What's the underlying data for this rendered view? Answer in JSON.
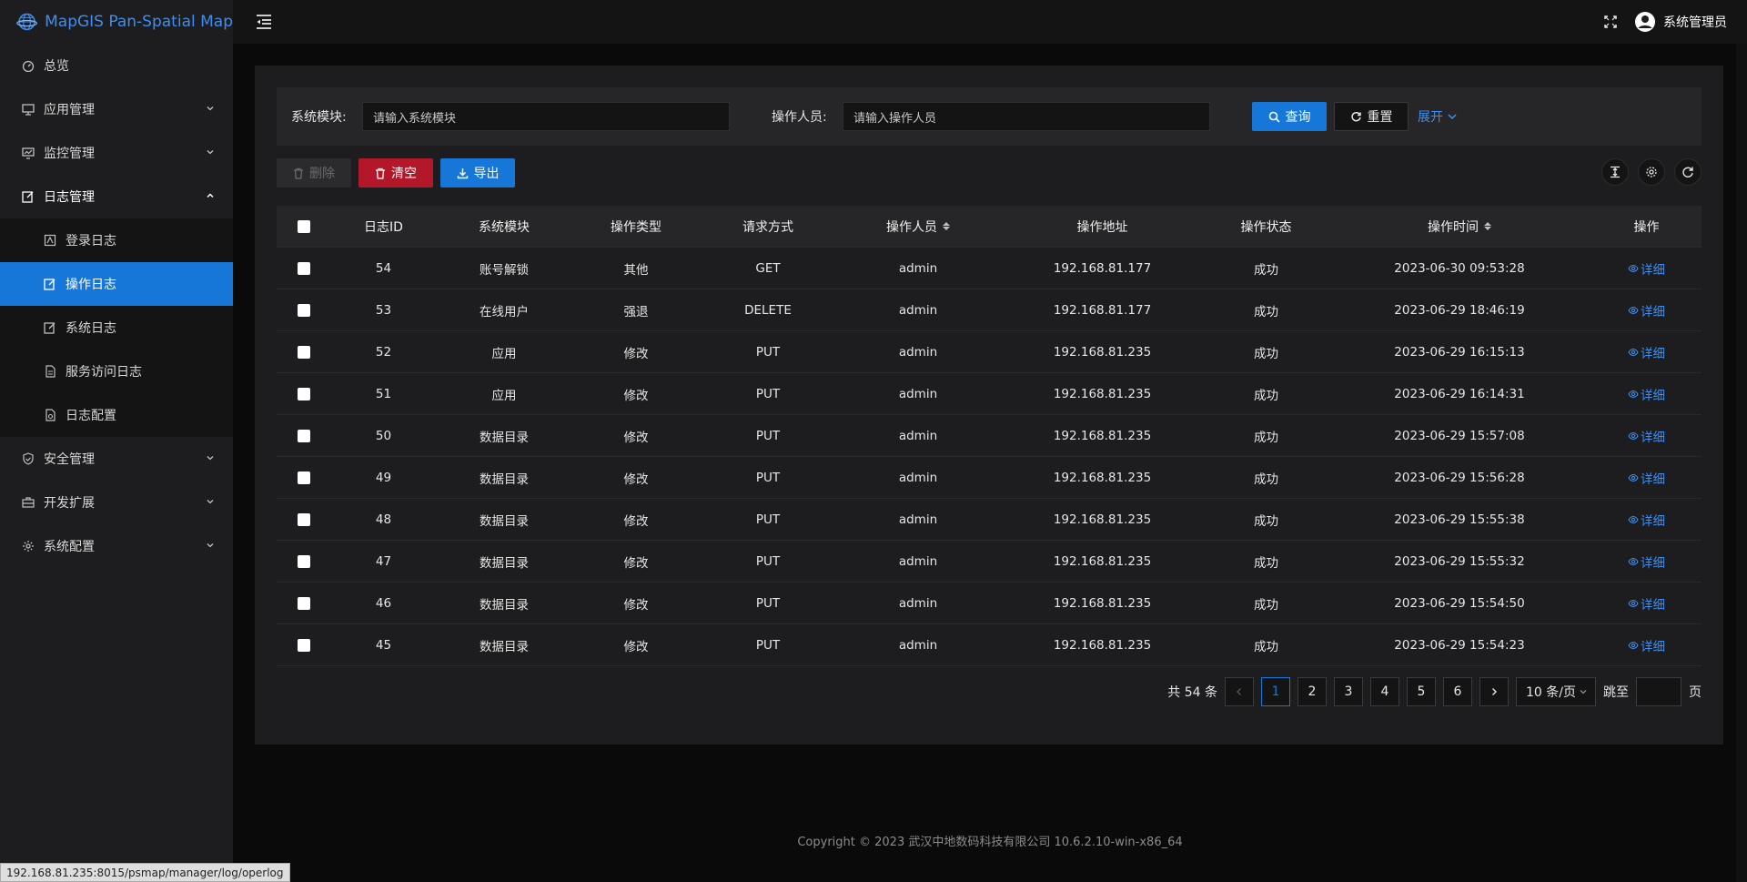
{
  "app": {
    "title": "MapGIS Pan-Spatial Map"
  },
  "colors": {
    "accent": "#1677d9",
    "danger": "#b3182a",
    "link": "#3d8ef0"
  },
  "sidebar": {
    "items": [
      {
        "label": "总览",
        "icon": "dashboard-icon"
      },
      {
        "label": "应用管理",
        "icon": "monitor-icon"
      },
      {
        "label": "监控管理",
        "icon": "chart-monitor-icon"
      },
      {
        "label": "日志管理",
        "icon": "edit-log-icon"
      },
      {
        "label": "安全管理",
        "icon": "shield-icon"
      },
      {
        "label": "开发扩展",
        "icon": "toolbox-icon"
      },
      {
        "label": "系统配置",
        "icon": "gear-icon"
      }
    ],
    "log_sub": [
      {
        "label": "登录日志",
        "icon": "login-log-icon"
      },
      {
        "label": "操作日志",
        "icon": "edit-icon"
      },
      {
        "label": "系统日志",
        "icon": "edit-icon"
      },
      {
        "label": "服务访问日志",
        "icon": "file-icon"
      },
      {
        "label": "日志配置",
        "icon": "file-config-icon"
      }
    ]
  },
  "header": {
    "user": "系统管理员"
  },
  "search": {
    "module_label": "系统模块:",
    "module_placeholder": "请输入系统模块",
    "operator_label": "操作人员:",
    "operator_placeholder": "请输入操作人员",
    "query": "查询",
    "reset": "重置",
    "expand": "展开"
  },
  "toolbar": {
    "delete": "删除",
    "clear": "清空",
    "export": "导出"
  },
  "table": {
    "columns": [
      "日志ID",
      "系统模块",
      "操作类型",
      "请求方式",
      "操作人员",
      "操作地址",
      "操作状态",
      "操作时间",
      "操作"
    ],
    "detail_label": "详细",
    "rows": [
      [
        "54",
        "账号解锁",
        "其他",
        "GET",
        "admin",
        "192.168.81.177",
        "成功",
        "2023-06-30 09:53:28"
      ],
      [
        "53",
        "在线用户",
        "强退",
        "DELETE",
        "admin",
        "192.168.81.177",
        "成功",
        "2023-06-29 18:46:19"
      ],
      [
        "52",
        "应用",
        "修改",
        "PUT",
        "admin",
        "192.168.81.235",
        "成功",
        "2023-06-29 16:15:13"
      ],
      [
        "51",
        "应用",
        "修改",
        "PUT",
        "admin",
        "192.168.81.235",
        "成功",
        "2023-06-29 16:14:31"
      ],
      [
        "50",
        "数据目录",
        "修改",
        "PUT",
        "admin",
        "192.168.81.235",
        "成功",
        "2023-06-29 15:57:08"
      ],
      [
        "49",
        "数据目录",
        "修改",
        "PUT",
        "admin",
        "192.168.81.235",
        "成功",
        "2023-06-29 15:56:28"
      ],
      [
        "48",
        "数据目录",
        "修改",
        "PUT",
        "admin",
        "192.168.81.235",
        "成功",
        "2023-06-29 15:55:38"
      ],
      [
        "47",
        "数据目录",
        "修改",
        "PUT",
        "admin",
        "192.168.81.235",
        "成功",
        "2023-06-29 15:55:32"
      ],
      [
        "46",
        "数据目录",
        "修改",
        "PUT",
        "admin",
        "192.168.81.235",
        "成功",
        "2023-06-29 15:54:50"
      ],
      [
        "45",
        "数据目录",
        "修改",
        "PUT",
        "admin",
        "192.168.81.235",
        "成功",
        "2023-06-29 15:54:23"
      ]
    ]
  },
  "pagination": {
    "total": "共 54 条",
    "pages": [
      "1",
      "2",
      "3",
      "4",
      "5",
      "6"
    ],
    "current": "1",
    "page_size": "10 条/页",
    "jump_label": "跳至",
    "page_suffix": "页"
  },
  "footer": {
    "copyright": "Copyright © 2023 武汉中地数码科技有限公司 10.6.2.10-win-x86_64"
  },
  "statusbar": {
    "url": "192.168.81.235:8015/psmap/manager/log/operlog"
  }
}
